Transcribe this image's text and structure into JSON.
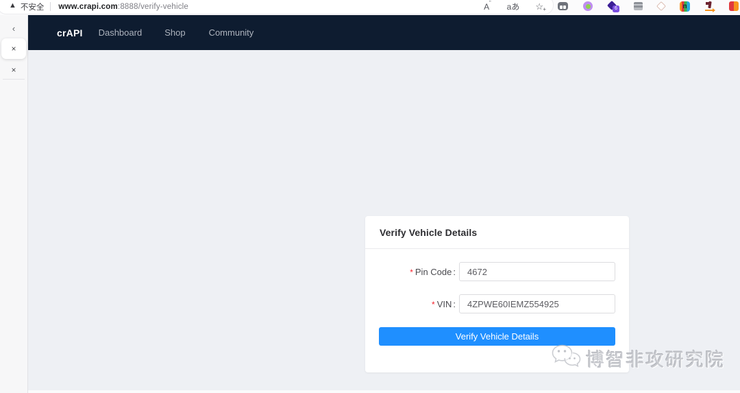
{
  "browser": {
    "security_label": "不安全",
    "url": {
      "host": "www.crapi.com",
      "path": ":8888/verify-vehicle"
    },
    "toolbar_icons": {
      "read_aloud_glyph": "A",
      "read_aloud_mark": "ʺ",
      "translate_glyph": "aあ",
      "favorite_glyph": "☆",
      "favorite_plus": "+"
    },
    "extension_badge": "6",
    "rainbow_ext_letter": "n"
  },
  "tab_sidebar": {
    "collapse_glyph": "‹",
    "close_glyph_1": "×",
    "close_glyph_2": "×"
  },
  "navbar": {
    "brand": "crAPI",
    "items": [
      {
        "label": "Dashboard"
      },
      {
        "label": "Shop"
      },
      {
        "label": "Community"
      }
    ]
  },
  "verify_card": {
    "title": "Verify Vehicle Details",
    "required_mark": "*",
    "colon": ":",
    "fields": [
      {
        "label": "Pin Code",
        "value": "4672"
      },
      {
        "label": "VIN",
        "value": "4ZPWE60IEMZ554925"
      }
    ],
    "submit_label": "Verify Vehicle Details"
  },
  "watermark": {
    "text": "博智非攻研究院"
  },
  "colors": {
    "navbar_bg": "#0e1c30",
    "page_bg": "#eef0f4",
    "primary_button": "#1f8fff",
    "required_mark": "#f5222d"
  }
}
